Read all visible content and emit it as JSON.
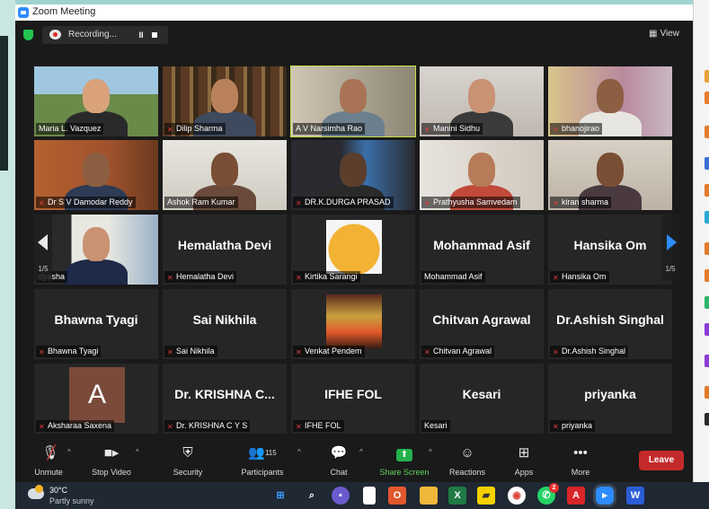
{
  "window": {
    "title": "Zoom Meeting"
  },
  "topbar": {
    "recording_label": "Recording...",
    "view_label": "View",
    "pause_symbol": "II"
  },
  "participants": [
    {
      "name": "Maria L. Vazquez",
      "muted": false,
      "type": "video"
    },
    {
      "name": "Dilip Sharma",
      "muted": true,
      "type": "video"
    },
    {
      "name": "A V Narsimha Rao",
      "muted": false,
      "type": "video",
      "active": true
    },
    {
      "name": "Manini Sidhu",
      "muted": true,
      "type": "video"
    },
    {
      "name": "bhanojirao",
      "muted": true,
      "type": "video"
    },
    {
      "name": "Dr S V Damodar Reddy",
      "muted": true,
      "type": "video"
    },
    {
      "name": "Ashok Ram Kumar",
      "muted": false,
      "type": "video"
    },
    {
      "name": "DR.K.DURGA PRASAD",
      "muted": true,
      "type": "video"
    },
    {
      "name": "Prathyusha Samvedam",
      "muted": true,
      "type": "video"
    },
    {
      "name": "kiran sharma",
      "muted": true,
      "type": "video"
    },
    {
      "name": "dyasha",
      "muted": false,
      "type": "video"
    },
    {
      "name": "Hemalatha Devi",
      "display": "Hemalatha Devi",
      "muted": true,
      "type": "name"
    },
    {
      "name": "Kirtika Sarangi",
      "muted": true,
      "type": "photo"
    },
    {
      "name": "Mohammad Asif",
      "display": "Mohammad Asif",
      "muted": false,
      "type": "name"
    },
    {
      "name": "Hansika Om",
      "display": "Hansika Om",
      "muted": true,
      "type": "name"
    },
    {
      "name": "Bhawna Tyagi",
      "display": "Bhawna Tyagi",
      "muted": true,
      "type": "name"
    },
    {
      "name": "Sai Nikhila",
      "display": "Sai Nikhila",
      "muted": true,
      "type": "name"
    },
    {
      "name": "Venkat Pendem",
      "muted": true,
      "type": "photo2"
    },
    {
      "name": "Chitvan Agrawal",
      "display": "Chitvan Agrawal",
      "muted": true,
      "type": "name"
    },
    {
      "name": "Dr.Ashish Singhal",
      "display": "Dr.Ashish Singhal",
      "muted": true,
      "type": "name"
    },
    {
      "name": "Aksharaa Saxena",
      "display": "A",
      "muted": true,
      "type": "avatar"
    },
    {
      "name": "Dr. KRISHNA C Y S",
      "display": "Dr. KRISHNA C...",
      "muted": true,
      "type": "name"
    },
    {
      "name": "IFHE FOL",
      "display": "IFHE FOL",
      "muted": true,
      "type": "name"
    },
    {
      "name": "Kesari",
      "display": "Kesari",
      "muted": false,
      "type": "name"
    },
    {
      "name": "priyanka",
      "display": "priyanka",
      "muted": true,
      "type": "name"
    }
  ],
  "pagination": {
    "left": "1/5",
    "right": "1/5"
  },
  "toolbar": {
    "unmute": "Unmute",
    "stop_video": "Stop Video",
    "security": "Security",
    "participants": "Participants",
    "participant_count": "115",
    "chat": "Chat",
    "share_screen": "Share Screen",
    "reactions": "Reactions",
    "apps": "Apps",
    "more": "More",
    "leave": "Leave"
  },
  "taskbar": {
    "temperature": "30°C",
    "weather": "Partly sunny",
    "whatsapp_badge": "2"
  },
  "colors": {
    "accent_green": "#23b14d",
    "leave_red": "#c42a2a",
    "active_speaker": "#c5e04a",
    "zoom_blue": "#2d8cff"
  }
}
